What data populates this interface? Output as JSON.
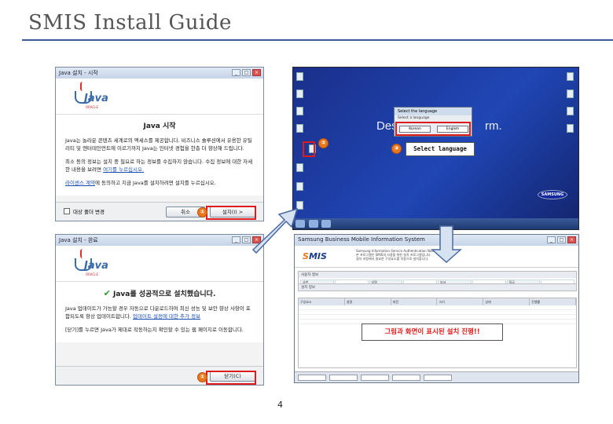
{
  "slide": {
    "title": "SMIS Install Guide",
    "page_number": "4"
  },
  "java_start": {
    "window_title": "Java 설치 - 시작",
    "logo_text": "Java",
    "logo_sub": "ORACLE",
    "heading": "Java 시작",
    "paragraph1": "Java는 놀라운 콘텐츠 세계로의 액세스를 제공합니다. 비즈니스 솔루션에서 유용한 유틸리티 및 엔터테인먼트에 이르기까지 Java는 인터넷 경험을 한층 더 향상해 드립니다.",
    "paragraph2": "최소 등의 정보는 설치 중 필요로 하는 정보를 수집하지 않습니다. 수집 정보에 대한 자세한 내용을 보려면",
    "paragraph2_link": "여기를 누르십시오.",
    "paragraph3_link": "라이센스 계약",
    "paragraph3": "에 동의하고 지금 Java를 설치하려면 설치를 누르십시오.",
    "checkbox_label": "대상 폴더 변경",
    "cancel_label": "취소",
    "install_label": "설치(I) >",
    "step": "①"
  },
  "java_done": {
    "window_title": "Java 설치 - 완료",
    "logo_text": "Java",
    "logo_sub": "ORACLE",
    "heading": "Java를 성공적으로 설치했습니다.",
    "paragraph1": "Java 업데이트가 가능할 경우 자동으로 다운로드하여 최신 성능 및 보안 향상 사항이 포함되도록 항상 업데이트합니다.",
    "paragraph1_link": "업데이트 설정에 대한 추가 정보",
    "paragraph2": "[닫기]를 누르면 Java가 제대로 작동하는지 확인할 수 있는 웹 페이지로 이동합니다.",
    "close_label": "닫기(C)",
    "step": "①"
  },
  "desktop": {
    "design_text": "Design",
    "rm_text": "rm.",
    "lang_dialog_title": "Select the language",
    "lang_dialog_hint": "Select a language",
    "lang_korean": "Korean",
    "lang_english": "English",
    "callout": "Select language",
    "samsung_logo": "SAMSUNG",
    "step_a": "②",
    "step_b": "③"
  },
  "smis": {
    "window_title": "Samsung Business Mobile Information System",
    "logo_s": "S",
    "logo_rest": "MIS",
    "info_lines": [
      "Samsung Information Service Authentication Notice",
      "본 프로그램은 SMIS의 사용을 위한 설치 프로그램입니다.",
      "설치 과정에서 필요한 구성요소를 자동으로 설치합니다."
    ],
    "section1": "사용자 정보",
    "section2": "설치 정보",
    "grid_cells": [
      "사번",
      "",
      "성명",
      "",
      "부서",
      "",
      "직급",
      ""
    ],
    "grid2_cells": [
      "회사",
      "",
      "서버",
      "",
      "버전",
      "",
      "상태",
      ""
    ],
    "table_headers": [
      "구성요소",
      "설명",
      "버전",
      "크기",
      "상태",
      "진행률"
    ],
    "notice": "그림과 화면이 표시된 설치 진행!!"
  },
  "colors": {
    "highlight": "#e01b1b",
    "badge": "#e8781e",
    "rule": "#3a5a9a"
  }
}
